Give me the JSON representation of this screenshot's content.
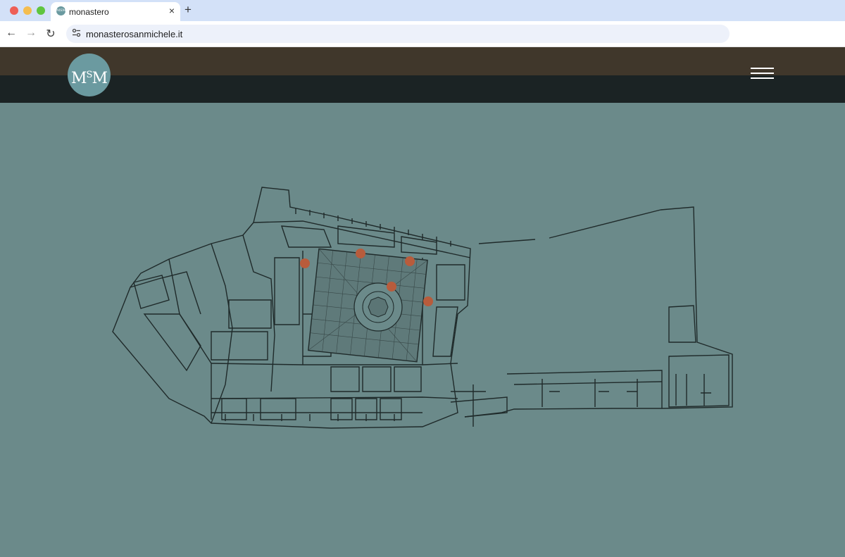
{
  "browser": {
    "tab_title": "monastero",
    "favicon_text": "MSM",
    "close_glyph": "×",
    "new_tab_glyph": "+",
    "url": "monasterosanmichele.it",
    "back_glyph": "←",
    "forward_glyph": "→",
    "reload_glyph": "↻"
  },
  "site": {
    "logo": {
      "m1": "M",
      "s": "S",
      "m2": "M"
    },
    "menu_icon": "hamburger-menu-icon",
    "colors": {
      "header_top": "#40372b",
      "header_bottom": "#1b2324",
      "logo_bg": "#6b9aa0",
      "map_bg": "#6b8a8a",
      "hotspot": "#b85c3c"
    }
  },
  "map": {
    "hotspots_count": 5
  }
}
